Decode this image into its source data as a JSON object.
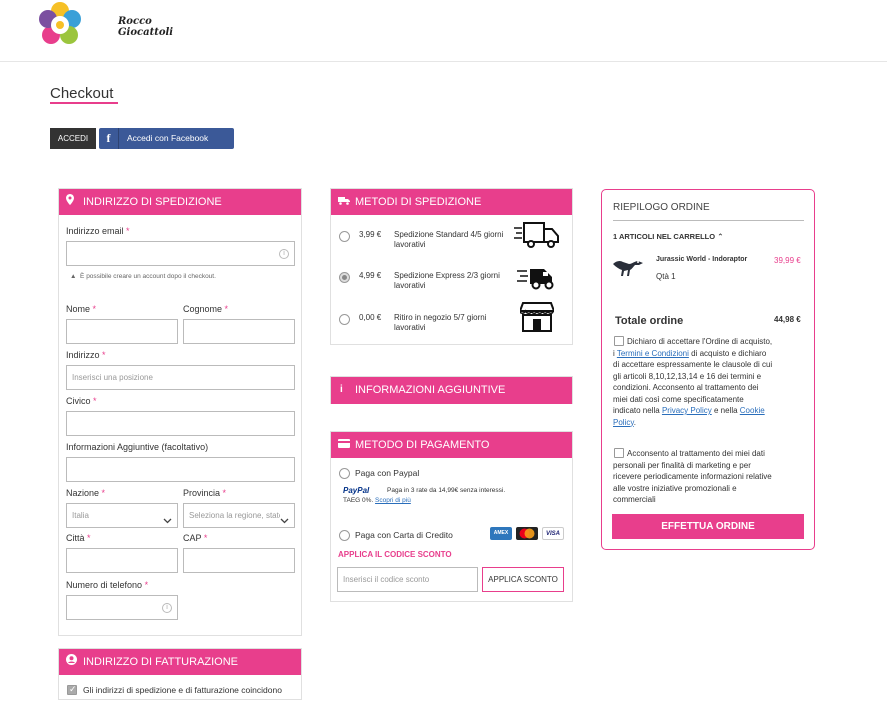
{
  "brand": {
    "line1": "Rocco",
    "line2": "Giocattoli",
    "accent": "#e83e8c"
  },
  "page": {
    "title": "Checkout"
  },
  "login": {
    "accedi_label": "ACCEDI",
    "facebook_label": "Accedi con Facebook",
    "facebook_glyph": "f"
  },
  "shipping_address": {
    "title": "INDIRIZZO DI SPEDIZIONE",
    "email_label": "Indirizzo email",
    "email_hint": "È possibile creare un account dopo il checkout.",
    "nome_label": "Nome",
    "cognome_label": "Cognome",
    "indirizzo_label": "Indirizzo",
    "indirizzo_placeholder": "Inserisci una posizione",
    "civico_label": "Civico",
    "info_label": "Informazioni Aggiuntive (facoltativo)",
    "nazione_label": "Nazione",
    "nazione_value": "Italia",
    "provincia_label": "Provincia",
    "provincia_value": "Seleziona la regione, stato",
    "citta_label": "Città",
    "cap_label": "CAP",
    "telefono_label": "Numero di telefono",
    "required_mark": "*"
  },
  "billing": {
    "title": "INDIRIZZO DI FATTURAZIONE",
    "same_label": "Gli indirizzi di spedizione e di fatturazione coincidono"
  },
  "shipping_methods": {
    "title": "METODI DI SPEDIZIONE",
    "options": [
      {
        "price": "3,99 €",
        "name": "Spedizione Standard 4/5 giorni lavorativi",
        "icon": "truck-icon",
        "selected": false
      },
      {
        "price": "4,99 €",
        "name": "Spedizione Express 2/3 giorni lavorativi",
        "icon": "fast-truck-icon",
        "selected": true
      },
      {
        "price": "0,00 €",
        "name": "Ritiro in negozio 5/7 giorni lavorativi",
        "icon": "store-icon",
        "selected": false
      }
    ]
  },
  "additional_info": {
    "title": "INFORMAZIONI AGGIUNTIVE"
  },
  "payment": {
    "title": "METODO DI PAGAMENTO",
    "paypal_label": "Paga con Paypal",
    "paypal_logo": "PayPal",
    "paypal_text": "Paga in 3 rate da 14,99€ senza interessi.",
    "paypal_taeg": "TAEG 0%.",
    "paypal_link": "Scopri di più",
    "card_label": "Paga con Carta di Credito",
    "cards": [
      "AMEX",
      "MC",
      "VISA"
    ],
    "discount_title": "APPLICA IL CODICE SCONTO",
    "discount_placeholder": "Inserisci il codice sconto",
    "discount_button": "APPLICA SCONTO"
  },
  "summary": {
    "title": "RIEPILOGO ORDINE",
    "cart_count": "1 ARTICOLI NEL CARRELLO",
    "item_name": "Jurassic World - Indoraptor",
    "item_price": "39,99 €",
    "item_qty": "Qtà 1",
    "total_label": "Totale ordine",
    "total_value": "44,98 €",
    "terms_pre": "Dichiaro di accettare l'Ordine di acquisto, i",
    "terms_link": "Termini e Condizioni",
    "terms_mid": "di acquisto e dichiaro di accettare espressamente le clausole di cui gli articoli 8,10,12,13,14 e 16 dei termini e condizioni. Acconsento al trattamento dei miei dati così come specificatamente indicato nella",
    "privacy_link": "Privacy Policy",
    "terms_and": "e nella",
    "cookie_link": "Cookie Policy",
    "terms_end": ".",
    "marketing_text": "Acconsento al trattamento dei miei dati personali per finalità di marketing e per ricevere periodicamente informazioni relative alle vostre iniziative promozionali e commerciali",
    "order_button": "EFFETTUA ORDINE"
  }
}
